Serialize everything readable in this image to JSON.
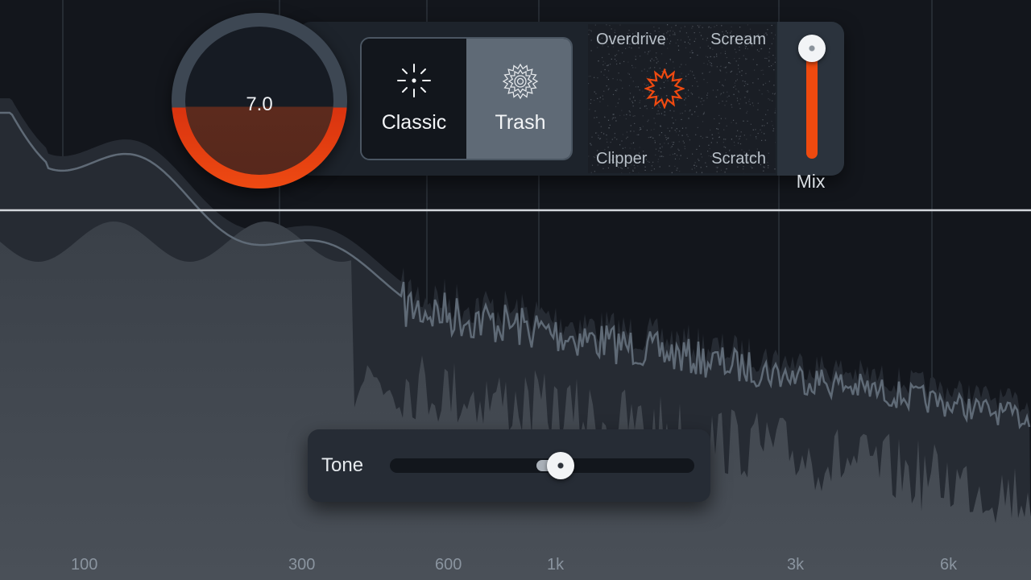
{
  "spectrum": {
    "freq_labels": [
      "100",
      "300",
      "600",
      "1k",
      "3k",
      "6k"
    ]
  },
  "drive_knob": {
    "value": "7.0",
    "level": 0.46,
    "track_color": "#3d4753",
    "active_color": "#ee4a12"
  },
  "modes": {
    "items": [
      {
        "label": "Classic",
        "icon": "sparkle-icon",
        "selected": false
      },
      {
        "label": "Trash",
        "icon": "mandala-icon",
        "selected": true
      }
    ]
  },
  "xy_pad": {
    "top_left": "Overdrive",
    "top_right": "Scream",
    "bottom_left": "Clipper",
    "bottom_right": "Scratch",
    "puck_icon": "starburst-icon",
    "puck_color": "#f04a10"
  },
  "mix": {
    "label": "Mix",
    "value": 1.0,
    "color": "#ee4a0f"
  },
  "tone": {
    "label": "Tone",
    "value": 0.56
  }
}
